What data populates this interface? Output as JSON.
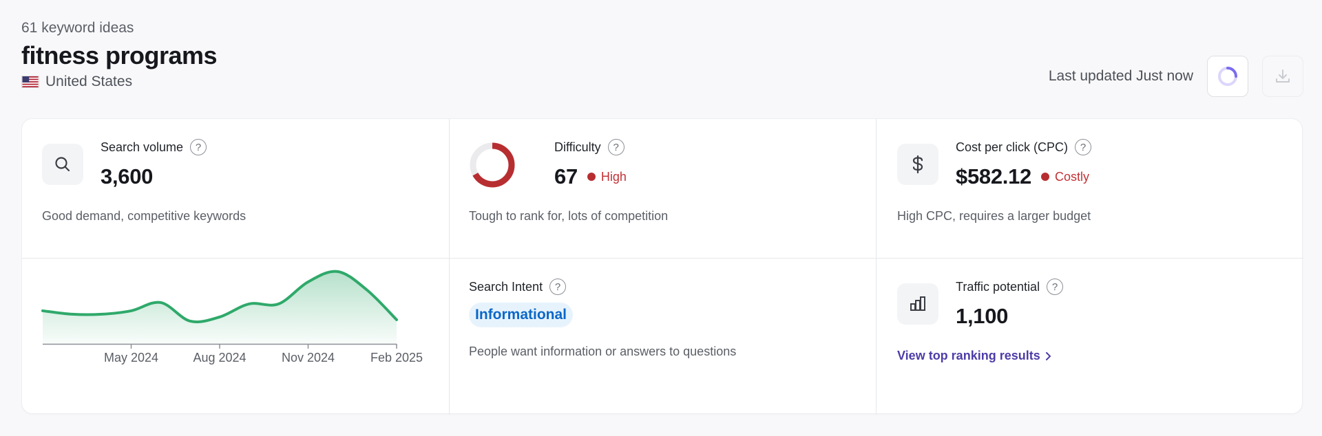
{
  "header": {
    "idea_count": "61 keyword ideas",
    "keyword": "fitness programs",
    "country": "United States",
    "flag_icon": "us-flag-icon",
    "last_updated": "Last updated Just now",
    "refresh_icon": "spinner-icon",
    "export_icon": "download-icon"
  },
  "metrics": {
    "search_volume": {
      "label": "Search volume",
      "value": "3,600",
      "description": "Good demand, competitive keywords",
      "icon": "search-icon"
    },
    "difficulty": {
      "label": "Difficulty",
      "value": "67",
      "level": "High",
      "level_fraction": 0.67,
      "description": "Tough to rank for, lots of competition",
      "color": "#b72e31"
    },
    "cpc": {
      "label": "Cost per click (CPC)",
      "value": "$582.12",
      "level": "Costly",
      "description": "High CPC, requires a larger budget",
      "icon": "dollar-icon"
    },
    "search_intent": {
      "label": "Search Intent",
      "value": "Informational",
      "description": "People want information or answers to questions"
    },
    "traffic_potential": {
      "label": "Traffic potential",
      "value": "1,100",
      "link": "View top ranking results",
      "icon": "bar-chart-icon"
    }
  },
  "chart_data": {
    "type": "area",
    "x": [
      "2024-02",
      "2024-03",
      "2024-04",
      "2024-05",
      "2024-06",
      "2024-07",
      "2024-08",
      "2024-09",
      "2024-10",
      "2024-11",
      "2024-12",
      "2025-01",
      "2025-02"
    ],
    "values": [
      48,
      43,
      43,
      48,
      60,
      33,
      39,
      58,
      58,
      90,
      105,
      78,
      35
    ],
    "tick_labels": [
      "May 2024",
      "Aug 2024",
      "Nov 2024",
      "Feb 2025"
    ],
    "tick_positions": [
      "2024-05",
      "2024-08",
      "2024-11",
      "2025-02"
    ],
    "ylim": [
      0,
      130
    ],
    "grid": false,
    "line_color": "#2fa96a"
  }
}
